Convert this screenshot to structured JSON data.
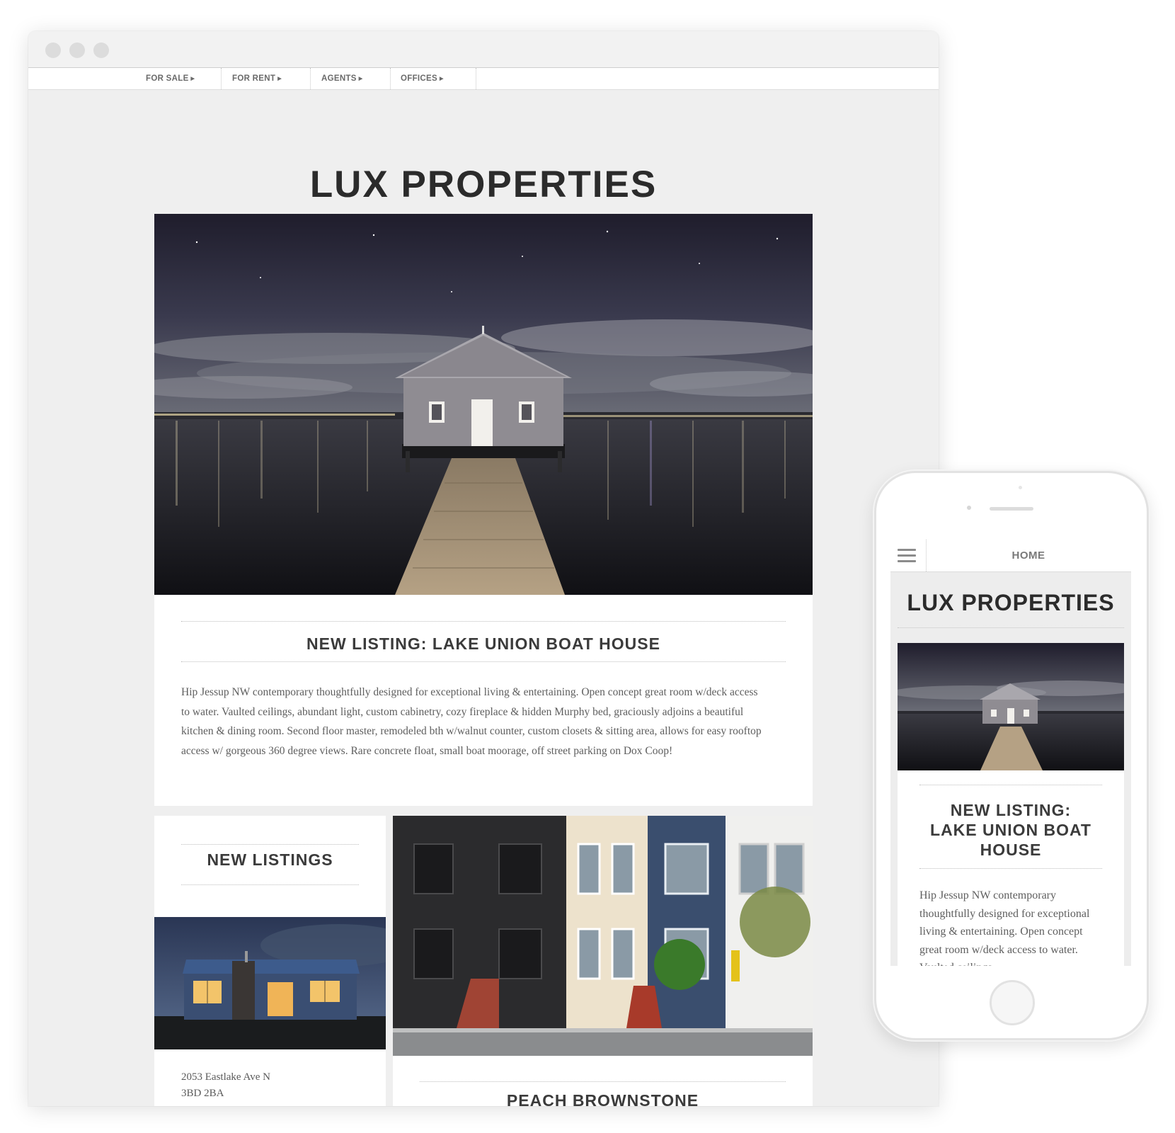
{
  "desktop": {
    "nav": [
      {
        "label": "FOR SALE"
      },
      {
        "label": "FOR RENT"
      },
      {
        "label": "AGENTS"
      },
      {
        "label": "OFFICES"
      }
    ],
    "site_title": "LUX PROPERTIES",
    "feature": {
      "title": "NEW LISTING: LAKE UNION BOAT HOUSE",
      "body": "Hip Jessup NW contemporary thoughtfully designed for exceptional living & entertaining. Open concept great room w/deck access to water. Vaulted ceilings, abundant light, custom cabinetry, cozy fireplace & hidden Murphy bed, graciously adjoins a beautiful kitchen & dining room. Second floor master, remodeled bth w/walnut counter, custom closets & sitting area, allows for easy rooftop access w/ gorgeous 360 degree views. Rare concrete float, small boat moorage, off street parking on Dox Coop!"
    },
    "new_listings": {
      "title": "NEW LISTINGS",
      "address_line1": "2053 Eastlake Ave N",
      "address_line2": "3BD 2BA"
    },
    "brownstone": {
      "title": "PEACH BROWNSTONE"
    }
  },
  "mobile": {
    "nav_home": "HOME",
    "site_title": "LUX PROPERTIES",
    "listing_title_line1": "NEW LISTING:",
    "listing_title_line2": "LAKE UNION BOAT",
    "listing_title_line3": "HOUSE",
    "listing_body": "Hip Jessup NW contemporary thoughtfully designed for exceptional living & entertaining. Open concept great room w/deck access to water. Vaulted ceilings,"
  },
  "icons": {
    "menu": "hamburger-menu-icon",
    "nav_arrow": "triangle-right-icon"
  },
  "colors": {
    "page_background": "#efefef",
    "title_text": "#2b2b2b",
    "nav_text": "#6a6a6a"
  }
}
